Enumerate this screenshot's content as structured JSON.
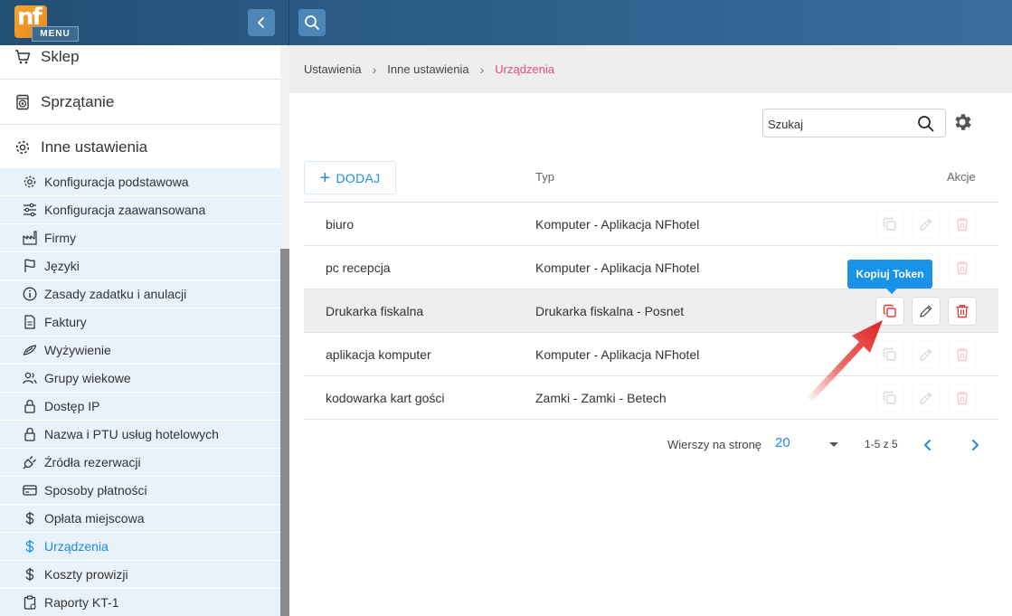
{
  "header": {
    "logo_text": "nf",
    "menu_label": "MENU"
  },
  "sidebar": {
    "main_items": [
      {
        "label": "Sklep",
        "icon": "cart-icon"
      },
      {
        "label": "Sprzątanie",
        "icon": "washer-icon"
      },
      {
        "label": "Inne ustawienia",
        "icon": "gear-icon"
      }
    ],
    "sub_items": [
      {
        "label": "Konfiguracja podstawowa",
        "icon": "gear-icon"
      },
      {
        "label": "Konfiguracja zaawansowana",
        "icon": "sliders-icon"
      },
      {
        "label": "Firmy",
        "icon": "factory-icon"
      },
      {
        "label": "Języki",
        "icon": "flag-icon"
      },
      {
        "label": "Zasady zadatku i anulacji",
        "icon": "info-icon"
      },
      {
        "label": "Faktury",
        "icon": "invoice-icon"
      },
      {
        "label": "Wyżywienie",
        "icon": "food-icon"
      },
      {
        "label": "Grupy wiekowe",
        "icon": "users-icon"
      },
      {
        "label": "Dostęp IP",
        "icon": "lock-icon"
      },
      {
        "label": "Nazwa i PTU usług hotelowych",
        "icon": "lock-icon"
      },
      {
        "label": "Źródła rezerwacji",
        "icon": "plug-icon"
      },
      {
        "label": "Sposoby płatności",
        "icon": "credit-card-icon"
      },
      {
        "label": "Opłata miejscowa",
        "icon": "dollar-icon"
      },
      {
        "label": "Urządzenia",
        "icon": "dollar-icon",
        "active": true
      },
      {
        "label": "Koszty prowizji",
        "icon": "dollar-icon"
      },
      {
        "label": "Raporty KT-1",
        "icon": "clipboard-icon"
      }
    ]
  },
  "breadcrumb": {
    "items": [
      "Ustawienia",
      "Inne ustawienia"
    ],
    "current": "Urządzenia"
  },
  "toolbar": {
    "search_placeholder": "Szukaj",
    "add_label": "DODAJ"
  },
  "table": {
    "columns": [
      "",
      "Typ",
      "Akcje"
    ],
    "rows": [
      {
        "name": "biuro",
        "type": "Komputer - Aplikacja NFhotel",
        "highlighted": false
      },
      {
        "name": "pc recepcja",
        "type": "Komputer - Aplikacja NFhotel",
        "highlighted": false
      },
      {
        "name": "Drukarka fiskalna",
        "type": "Drukarka fiskalna - Posnet",
        "highlighted": true
      },
      {
        "name": "aplikacja komputer",
        "type": "Komputer - Aplikacja NFhotel",
        "highlighted": false
      },
      {
        "name": "kodowarka kart gości",
        "type": "Zamki - Zamki - Betech",
        "highlighted": false
      }
    ]
  },
  "tooltip": {
    "text": "Kopiuj Token"
  },
  "pagination": {
    "rows_per_page_label": "Wierszy na stronę",
    "rows_per_page_value": "20",
    "range_text": "1-5 z 5"
  },
  "colors": {
    "accent": "#1e88e5",
    "breadcrumb_current": "#e84a7f",
    "delete": "#e53935",
    "tooltip": "#1a92e8",
    "topbar": "#2d5f8a"
  }
}
